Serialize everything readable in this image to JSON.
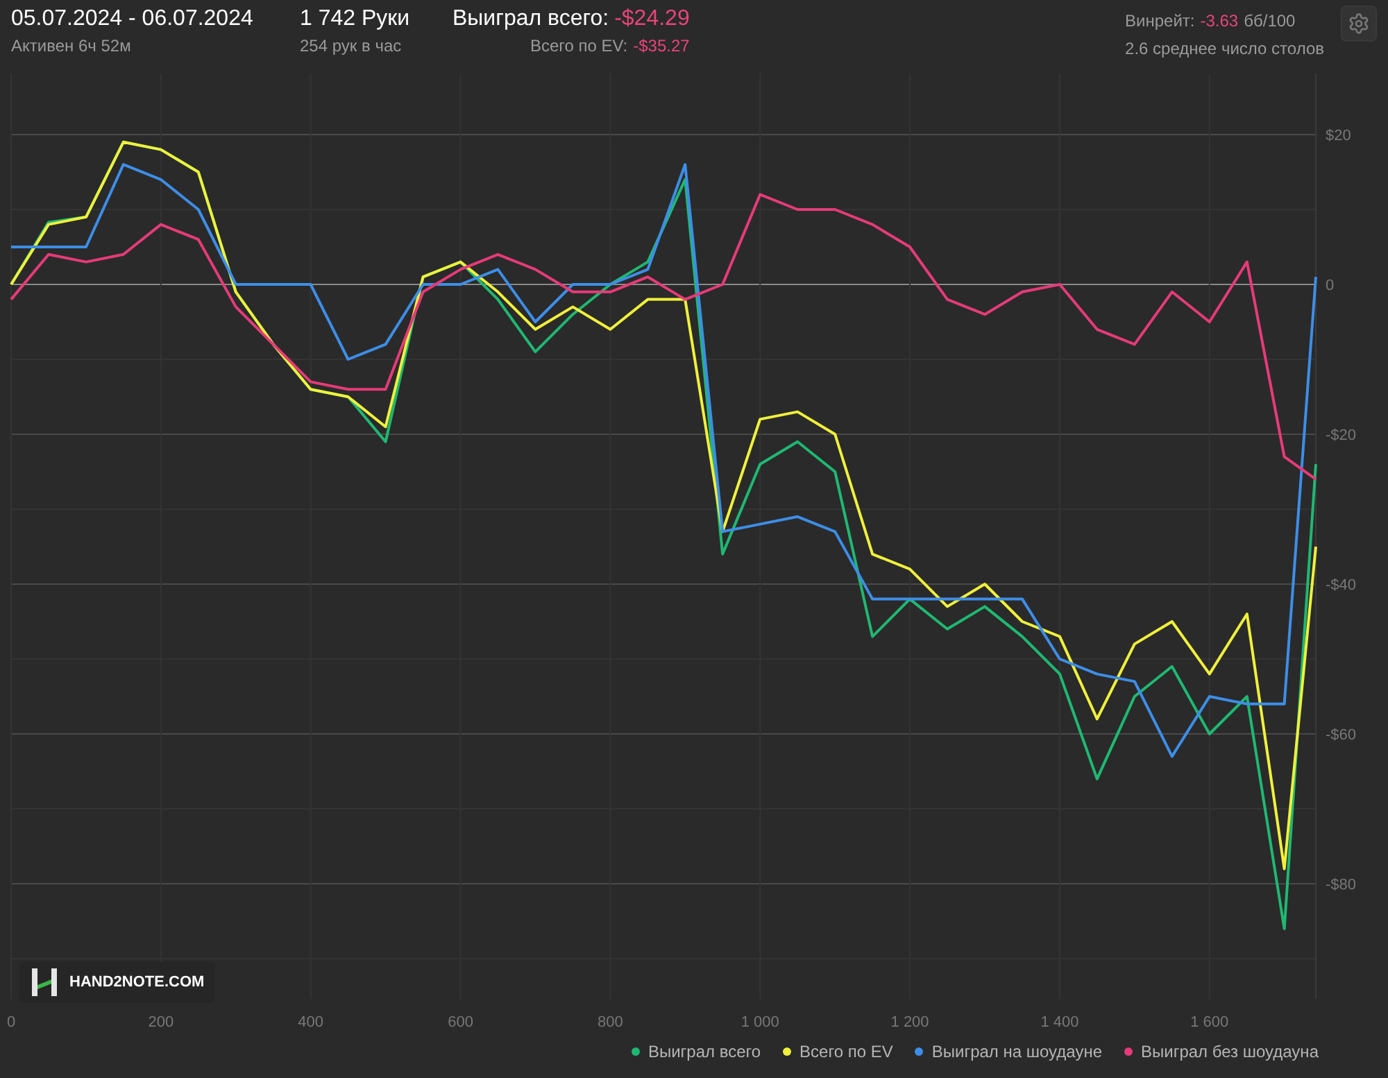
{
  "header": {
    "date_range": "05.07.2024 - 06.07.2024",
    "active_time": "Активен 6ч 52м",
    "hands": "1 742 Руки",
    "hands_per_hour": "254 рук в час",
    "won_label": "Выиграл всего:",
    "won_value": "-$24.29",
    "ev_label": "Всего по EV:",
    "ev_value": "-$35.27",
    "winrate_label": "Винрейт:",
    "winrate_value": "-3.63",
    "winrate_unit": "бб/100",
    "tables": "2.6 среднее число столов"
  },
  "logo": "HAND2NOTE.COM",
  "chart": {
    "chart_data": {
      "type": "line",
      "x": [
        0,
        50,
        100,
        150,
        200,
        250,
        300,
        350,
        400,
        450,
        500,
        550,
        600,
        650,
        700,
        750,
        800,
        850,
        900,
        950,
        1000,
        1050,
        1100,
        1150,
        1200,
        1250,
        1300,
        1350,
        1400,
        1450,
        1500,
        1550,
        1600,
        1650,
        1700,
        1742
      ],
      "grid": true,
      "xlim": [
        0,
        1742
      ],
      "ylim": [
        -95,
        28.7
      ],
      "xticks": [
        0,
        200,
        400,
        600,
        800,
        {
          "value": 1000,
          "label": "1 000"
        },
        {
          "value": 1200,
          "label": "1 200"
        },
        {
          "value": 1400,
          "label": "1 400"
        },
        {
          "value": 1600,
          "label": "1 600"
        }
      ],
      "yticks": [
        {
          "value": 20,
          "label": "$20"
        },
        {
          "value": 0,
          "label": "0"
        },
        {
          "value": -20,
          "label": "-$20"
        },
        {
          "value": -40,
          "label": "-$40"
        },
        {
          "value": -60,
          "label": "-$60"
        },
        {
          "value": -80,
          "label": "-$80"
        }
      ],
      "series": [
        {
          "name": "Выиграл всего",
          "color": "#1fb872",
          "values": [
            0,
            8.3,
            9,
            19,
            18,
            15,
            -1,
            -8,
            -14,
            -15,
            -21,
            1,
            3,
            -2,
            -9,
            -4,
            0,
            3,
            14,
            -36,
            -24,
            -21,
            -25,
            -47,
            -42,
            -46,
            -43,
            -47,
            -52,
            -66,
            -55,
            -51,
            -60,
            -55,
            -86,
            -24
          ]
        },
        {
          "name": "Всего по EV",
          "color": "#f0f03c",
          "values": [
            0,
            8,
            9,
            19,
            18,
            15,
            -1,
            -8,
            -14,
            -15,
            -19,
            1,
            3,
            -1,
            -6,
            -3,
            -6,
            -2,
            -2,
            -33,
            -18,
            -17,
            -20,
            -36,
            -38,
            -43,
            -40,
            -45,
            -47,
            -58,
            -48,
            -45,
            -52,
            -44,
            -78,
            -35
          ]
        },
        {
          "name": "Выиграл на шоудауне",
          "color": "#3d8ee8",
          "values": [
            5,
            5,
            5,
            16,
            14,
            10,
            0,
            0,
            0,
            -10,
            -8,
            0,
            0,
            2,
            -5,
            0,
            0,
            2,
            16,
            -33,
            -32,
            -31,
            -33,
            -42,
            -42,
            -42,
            -42,
            -42,
            -50,
            -52,
            -53,
            -63,
            -55,
            -56,
            -56,
            1
          ]
        },
        {
          "name": "Выиграл без шоудауна",
          "color": "#e63b78",
          "values": [
            -2,
            4,
            3,
            4,
            8,
            6,
            -3,
            -8,
            -13,
            -14,
            -14,
            -1,
            2,
            4,
            2,
            -1,
            -1,
            1,
            -2,
            0,
            12,
            10,
            10,
            8,
            5,
            -2,
            -4,
            -1,
            0,
            -6,
            -8,
            -1,
            -5,
            3,
            -23,
            -26
          ]
        }
      ]
    }
  }
}
